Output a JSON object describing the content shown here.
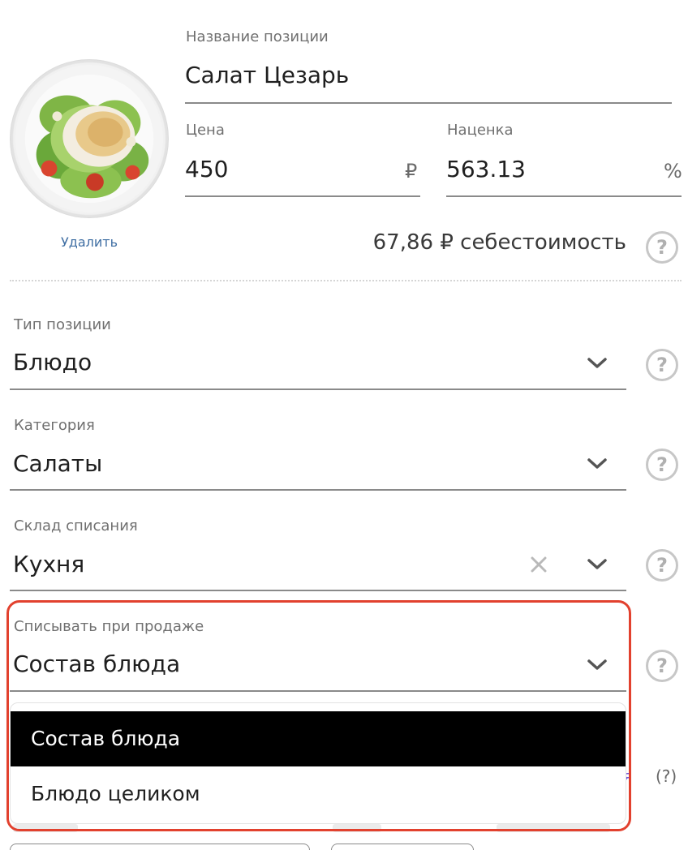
{
  "item": {
    "photo_alt": "Салат Цезарь",
    "delete_label": "Удалить",
    "name_label": "Название позиции",
    "name_value": "Салат Цезарь",
    "price_label": "Цена",
    "price_value": "450",
    "price_unit": "₽",
    "markup_label": "Наценка",
    "markup_value": "563.13",
    "markup_unit": "%",
    "cost_text": "67,86 ₽ себестоимость"
  },
  "fields": {
    "type": {
      "label": "Тип позиции",
      "value": "Блюдо"
    },
    "category": {
      "label": "Категория",
      "value": "Салаты"
    },
    "warehouse": {
      "label": "Склад списания",
      "value": "Кухня"
    },
    "writeoff": {
      "label": "Списывать при продаже",
      "value": "Состав блюда"
    }
  },
  "dropdown": {
    "options": [
      "Состав блюда",
      "Блюдо целиком"
    ],
    "selected_index": 0
  },
  "background_peek": {
    "link_text": "ая",
    "help_text": "(?)"
  },
  "colors": {
    "highlight": "#e2412e",
    "selected_option_bg": "#000000",
    "link": "#3f6ea3"
  },
  "icons": [
    "help-icon",
    "chevron-down-icon",
    "clear-icon"
  ]
}
